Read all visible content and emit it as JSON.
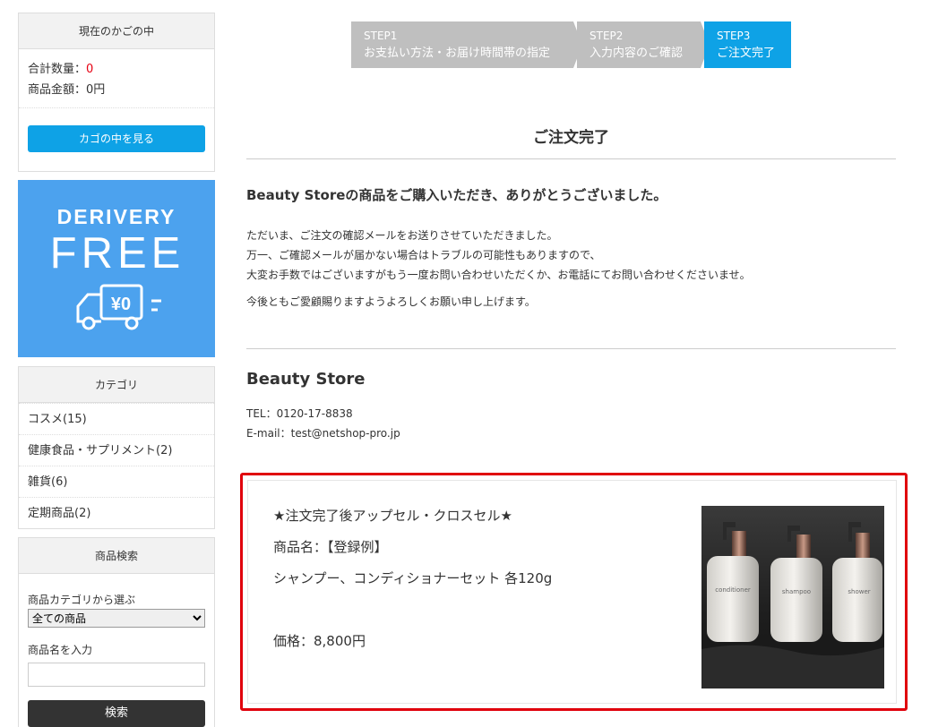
{
  "cart": {
    "header": "現在のかごの中",
    "qty_label": "合計数量：",
    "qty_value": "0",
    "amount_label": "商品金額：",
    "amount_value": "0円",
    "view_button": "カゴの中を見る"
  },
  "banner": {
    "line1": "DERIVERY",
    "line2": "FREE",
    "price_tag": "¥0"
  },
  "categories": {
    "header": "カテゴリ",
    "items": [
      "コスメ(15)",
      "健康食品・サプリメント(2)",
      "雑貨(6)",
      "定期商品(2)"
    ]
  },
  "search": {
    "header": "商品検索",
    "category_label": "商品カテゴリから選ぶ",
    "category_selected": "全ての商品",
    "name_label": "商品名を入力",
    "name_value": "",
    "button": "検索"
  },
  "steps": [
    {
      "num": "STEP1",
      "label": "お支払い方法・お届け時間帯の指定"
    },
    {
      "num": "STEP2",
      "label": "入力内容のご確認"
    },
    {
      "num": "STEP3",
      "label": "ご注文完了"
    }
  ],
  "colors": {
    "accent": "#0ea2e6",
    "step_inactive": "#bfbfbf",
    "banner": "#4ca2ee",
    "highlight": "#e0000c"
  },
  "page": {
    "title": "ご注文完了",
    "thanks": "Beauty Storeの商品をご購入いただき、ありがとうございました。",
    "message_lines": [
      "ただいま、ご注文の確認メールをお送りさせていただきました。",
      "万一、ご確認メールが届かない場合はトラブルの可能性もありますので、",
      "大変お手数ではございますがもう一度お問い合わせいただくか、お電話にてお問い合わせくださいませ。"
    ],
    "message2": "今後ともご愛顧賜りますようよろしくお願い申し上げます。"
  },
  "store": {
    "name": "Beauty Store",
    "tel": "TEL：0120-17-8838",
    "email": "E-mail：test@netshop-pro.jp"
  },
  "upsell": {
    "heading": "★注文完了後アップセル・クロスセル★",
    "product_name": "商品名：【登録例】",
    "description": "シャンプー、コンディショナーセット 各120g",
    "price": "価格：8,800円",
    "bottle_labels": [
      "conditioner",
      "shampoo",
      "shower"
    ]
  }
}
